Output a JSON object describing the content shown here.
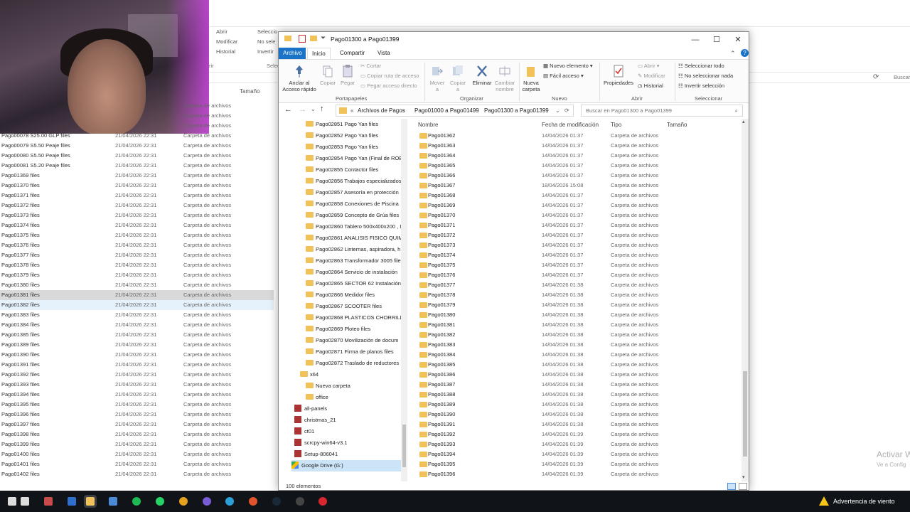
{
  "window": {
    "title": "Pago01300 a Pago01399",
    "tabs": [
      "Archivo",
      "Inicio",
      "Compartir",
      "Vista"
    ]
  },
  "ribbon": {
    "portapapeles": {
      "label": "Portapapeles",
      "anclar": "Anclar al\nAcceso rápido",
      "copiar": "Copiar",
      "pegar": "Pegar",
      "cortar": "Cortar",
      "copiar_ruta": "Copiar ruta de acceso",
      "pegar_acceso": "Pegar acceso directo"
    },
    "organizar": {
      "label": "Organizar",
      "mover": "Mover\na",
      "copiar": "Copiar\na",
      "eliminar": "Eliminar",
      "cambiar": "Cambiar\nnombre"
    },
    "nuevo": {
      "label": "Nuevo",
      "nueva_carpeta": "Nueva\ncarpeta",
      "nuevo_elemento": "Nuevo elemento",
      "facil_acceso": "Fácil acceso"
    },
    "abrir": {
      "label": "Abrir",
      "propiedades": "Propiedades",
      "abrir": "Abrir",
      "modificar": "Modificar",
      "historial": "Historial"
    },
    "seleccionar": {
      "label": "Seleccionar",
      "todo": "Seleccionar todo",
      "nada": "No seleccionar nada",
      "invertir": "Invertir selección"
    }
  },
  "address": {
    "crumbs": [
      "Archivos de Pagos",
      "Pago01000 a Pago01499",
      "Pago01300 a Pago01399"
    ],
    "search_placeholder": "Buscar en Pago01300 a Pago01399"
  },
  "nav": [
    {
      "label": "Pago02851 Pago Yan files",
      "indent": 1
    },
    {
      "label": "Pago02852 Pago Yan files",
      "indent": 1
    },
    {
      "label": "Pago02853 Pago Yan files",
      "indent": 1
    },
    {
      "label": "Pago02854 Pago Yan (Final de ROE",
      "indent": 1
    },
    {
      "label": "Pago02855 Contactor files",
      "indent": 1
    },
    {
      "label": "Pago02856 Trabajos especializados",
      "indent": 1
    },
    {
      "label": "Pago02857 Asesoría en protección",
      "indent": 1
    },
    {
      "label": "Pago02858 Conexiones de Piscina",
      "indent": 1
    },
    {
      "label": "Pago02859 Concepto de Grúa files",
      "indent": 1
    },
    {
      "label": "Pago02860 Tablero 500x400x200 , I",
      "indent": 1
    },
    {
      "label": "Pago02861 ANALISIS FISICO QUIM",
      "indent": 1
    },
    {
      "label": "Pago02862 Linternas, aspiradora, h",
      "indent": 1
    },
    {
      "label": "Pago02863 Transformador 3005 file",
      "indent": 1
    },
    {
      "label": "Pago02864 Servicio de instalación",
      "indent": 1
    },
    {
      "label": "Pago02865 SECTOR 62 Instalación",
      "indent": 1
    },
    {
      "label": "Pago02866 Medidor files",
      "indent": 1
    },
    {
      "label": "Pago02867 SCOOTER files",
      "indent": 1
    },
    {
      "label": "Pago02868 PLASTICOS CHORRILLC",
      "indent": 1
    },
    {
      "label": "Pago02869 Ploteo files",
      "indent": 1
    },
    {
      "label": "Pago02870 Movilización de docum",
      "indent": 1
    },
    {
      "label": "Pago02871 Firma de planos files",
      "indent": 1
    },
    {
      "label": "Pago02872 Traslado de reductores",
      "indent": 1
    },
    {
      "label": "x64",
      "indent": 0
    },
    {
      "label": "Nueva carpeta",
      "indent": 0
    },
    {
      "label": "office",
      "indent": 0
    },
    {
      "label": "all-panels",
      "indent": -1
    },
    {
      "label": "christmas_21",
      "indent": -1
    },
    {
      "label": "ct01",
      "indent": -1
    },
    {
      "label": "scrcpy-win64-v3.1",
      "indent": -1
    },
    {
      "label": "Setup-806041",
      "indent": -1
    },
    {
      "label": "Google Drive (G:)",
      "indent": -2
    }
  ],
  "columns": {
    "name": "Nombre",
    "date": "Fecha de modificación",
    "type": "Tipo",
    "size": "Tamaño"
  },
  "files": [
    {
      "name": "Pago01362",
      "date": "14/04/2026 01:37",
      "type": "Carpeta de archivos"
    },
    {
      "name": "Pago01363",
      "date": "14/04/2026 01:37",
      "type": "Carpeta de archivos"
    },
    {
      "name": "Pago01364",
      "date": "14/04/2026 01:37",
      "type": "Carpeta de archivos"
    },
    {
      "name": "Pago01365",
      "date": "14/04/2026 01:37",
      "type": "Carpeta de archivos"
    },
    {
      "name": "Pago01366",
      "date": "14/04/2026 01:37",
      "type": "Carpeta de archivos"
    },
    {
      "name": "Pago01367",
      "date": "18/04/2026 15:08",
      "type": "Carpeta de archivos"
    },
    {
      "name": "Pago01368",
      "date": "14/04/2026 01:37",
      "type": "Carpeta de archivos"
    },
    {
      "name": "Pago01369",
      "date": "14/04/2026 01:37",
      "type": "Carpeta de archivos"
    },
    {
      "name": "Pago01370",
      "date": "14/04/2026 01:37",
      "type": "Carpeta de archivos"
    },
    {
      "name": "Pago01371",
      "date": "14/04/2026 01:37",
      "type": "Carpeta de archivos"
    },
    {
      "name": "Pago01372",
      "date": "14/04/2026 01:37",
      "type": "Carpeta de archivos"
    },
    {
      "name": "Pago01373",
      "date": "14/04/2026 01:37",
      "type": "Carpeta de archivos"
    },
    {
      "name": "Pago01374",
      "date": "14/04/2026 01:37",
      "type": "Carpeta de archivos"
    },
    {
      "name": "Pago01375",
      "date": "14/04/2026 01:37",
      "type": "Carpeta de archivos"
    },
    {
      "name": "Pago01376",
      "date": "14/04/2026 01:37",
      "type": "Carpeta de archivos"
    },
    {
      "name": "Pago01377",
      "date": "14/04/2026 01:38",
      "type": "Carpeta de archivos"
    },
    {
      "name": "Pago01378",
      "date": "14/04/2026 01:38",
      "type": "Carpeta de archivos"
    },
    {
      "name": "Pago01379",
      "date": "14/04/2026 01:38",
      "type": "Carpeta de archivos"
    },
    {
      "name": "Pago01380",
      "date": "14/04/2026 01:38",
      "type": "Carpeta de archivos"
    },
    {
      "name": "Pago01381",
      "date": "14/04/2026 01:38",
      "type": "Carpeta de archivos"
    },
    {
      "name": "Pago01382",
      "date": "14/04/2026 01:38",
      "type": "Carpeta de archivos"
    },
    {
      "name": "Pago01383",
      "date": "14/04/2026 01:38",
      "type": "Carpeta de archivos"
    },
    {
      "name": "Pago01384",
      "date": "14/04/2026 01:38",
      "type": "Carpeta de archivos"
    },
    {
      "name": "Pago01385",
      "date": "14/04/2026 01:38",
      "type": "Carpeta de archivos"
    },
    {
      "name": "Pago01386",
      "date": "14/04/2026 01:38",
      "type": "Carpeta de archivos"
    },
    {
      "name": "Pago01387",
      "date": "14/04/2026 01:38",
      "type": "Carpeta de archivos"
    },
    {
      "name": "Pago01388",
      "date": "14/04/2026 01:38",
      "type": "Carpeta de archivos"
    },
    {
      "name": "Pago01389",
      "date": "14/04/2026 01:38",
      "type": "Carpeta de archivos"
    },
    {
      "name": "Pago01390",
      "date": "14/04/2026 01:38",
      "type": "Carpeta de archivos"
    },
    {
      "name": "Pago01391",
      "date": "14/04/2026 01:38",
      "type": "Carpeta de archivos"
    },
    {
      "name": "Pago01392",
      "date": "14/04/2026 01:39",
      "type": "Carpeta de archivos"
    },
    {
      "name": "Pago01393",
      "date": "14/04/2026 01:39",
      "type": "Carpeta de archivos"
    },
    {
      "name": "Pago01394",
      "date": "14/04/2026 01:39",
      "type": "Carpeta de archivos"
    },
    {
      "name": "Pago01395",
      "date": "14/04/2026 01:39",
      "type": "Carpeta de archivos"
    },
    {
      "name": "Pago01396",
      "date": "14/04/2026 01:39",
      "type": "Carpeta de archivos"
    }
  ],
  "status": "100 elementos",
  "bg_window": {
    "ribbon": [
      "Abrir",
      "Modificar",
      "Historial",
      "Seleccio",
      "No sele",
      "Invertir"
    ],
    "group_abrir": "rir",
    "group_sel": "Selec",
    "size_header": "Tamaño",
    "search": "Buscar",
    "rows": [
      {
        "name": "",
        "date": "",
        "type": "Carpeta de archivos"
      },
      {
        "name": "",
        "date": "",
        "type": "Carpeta de archivos"
      },
      {
        "name": "",
        "date": "",
        "type": "Carpeta de archivos"
      },
      {
        "name": "Pago00078 S25.00 GLP files",
        "date": "21/04/2026 22:31",
        "type": "Carpeta de archivos"
      },
      {
        "name": "Pago00079 S5.50 Peaje files",
        "date": "21/04/2026 22:31",
        "type": "Carpeta de archivos"
      },
      {
        "name": "Pago00080 S5.50 Peaje files",
        "date": "21/04/2026 22:31",
        "type": "Carpeta de archivos"
      },
      {
        "name": "Pago00081 S5.20 Peaje files",
        "date": "21/04/2026 22:31",
        "type": "Carpeta de archivos"
      },
      {
        "name": "Pago01369 files",
        "date": "21/04/2026 22:31",
        "type": "Carpeta de archivos"
      },
      {
        "name": "Pago01370 files",
        "date": "21/04/2026 22:31",
        "type": "Carpeta de archivos"
      },
      {
        "name": "Pago01371 files",
        "date": "21/04/2026 22:31",
        "type": "Carpeta de archivos"
      },
      {
        "name": "Pago01372 files",
        "date": "21/04/2026 22:31",
        "type": "Carpeta de archivos"
      },
      {
        "name": "Pago01373 files",
        "date": "21/04/2026 22:31",
        "type": "Carpeta de archivos"
      },
      {
        "name": "Pago01374 files",
        "date": "21/04/2026 22:31",
        "type": "Carpeta de archivos"
      },
      {
        "name": "Pago01375 files",
        "date": "21/04/2026 22:31",
        "type": "Carpeta de archivos"
      },
      {
        "name": "Pago01376 files",
        "date": "21/04/2026 22:31",
        "type": "Carpeta de archivos"
      },
      {
        "name": "Pago01377 files",
        "date": "21/04/2026 22:31",
        "type": "Carpeta de archivos"
      },
      {
        "name": "Pago01378 files",
        "date": "21/04/2026 22:31",
        "type": "Carpeta de archivos"
      },
      {
        "name": "Pago01379 files",
        "date": "21/04/2026 22:31",
        "type": "Carpeta de archivos"
      },
      {
        "name": "Pago01380 files",
        "date": "21/04/2026 22:31",
        "type": "Carpeta de archivos"
      },
      {
        "name": "Pago01381 files",
        "date": "21/04/2026 22:31",
        "type": "Carpeta de archivos"
      },
      {
        "name": "Pago01382 files",
        "date": "21/04/2026 22:31",
        "type": "Carpeta de archivos"
      },
      {
        "name": "Pago01383 files",
        "date": "21/04/2026 22:31",
        "type": "Carpeta de archivos"
      },
      {
        "name": "Pago01384 files",
        "date": "21/04/2026 22:31",
        "type": "Carpeta de archivos"
      },
      {
        "name": "Pago01385 files",
        "date": "21/04/2026 22:31",
        "type": "Carpeta de archivos"
      },
      {
        "name": "Pago01389 files",
        "date": "21/04/2026 22:31",
        "type": "Carpeta de archivos"
      },
      {
        "name": "Pago01390 files",
        "date": "21/04/2026 22:31",
        "type": "Carpeta de archivos"
      },
      {
        "name": "Pago01391 files",
        "date": "21/04/2026 22:31",
        "type": "Carpeta de archivos"
      },
      {
        "name": "Pago01392 files",
        "date": "21/04/2026 22:31",
        "type": "Carpeta de archivos"
      },
      {
        "name": "Pago01393 files",
        "date": "21/04/2026 22:31",
        "type": "Carpeta de archivos"
      },
      {
        "name": "Pago01394 files",
        "date": "21/04/2026 22:31",
        "type": "Carpeta de archivos"
      },
      {
        "name": "Pago01395 files",
        "date": "21/04/2026 22:31",
        "type": "Carpeta de archivos"
      },
      {
        "name": "Pago01396 files",
        "date": "21/04/2026 22:31",
        "type": "Carpeta de archivos"
      },
      {
        "name": "Pago01397 files",
        "date": "21/04/2026 22:31",
        "type": "Carpeta de archivos"
      },
      {
        "name": "Pago01398 files",
        "date": "21/04/2026 22:31",
        "type": "Carpeta de archivos"
      },
      {
        "name": "Pago01399 files",
        "date": "21/04/2026 22:31",
        "type": "Carpeta de archivos"
      },
      {
        "name": "Pago01400 files",
        "date": "21/04/2026 22:31",
        "type": "Carpeta de archivos"
      },
      {
        "name": "Pago01401 files",
        "date": "21/04/2026 22:31",
        "type": "Carpeta de archivos"
      },
      {
        "name": "Pago01402 files",
        "date": "21/04/2026 22:31",
        "type": "Carpeta de archivos"
      }
    ]
  },
  "activation": {
    "line1": "Activar W",
    "line2": "Ve a Config"
  },
  "taskbar": {
    "icons": [
      "search-icon",
      "task-view-icon",
      "calculator-icon",
      "outlook-icon",
      "explorer-icon",
      "mail-icon",
      "spotify-icon",
      "whatsapp-icon",
      "chrome-icon",
      "discord-icon",
      "edge-icon",
      "brave-icon",
      "steam-icon",
      "obs-icon",
      "opera-icon"
    ],
    "wind_warning": "Advertencia de viento"
  },
  "colors": {
    "accent": "#1a73c6",
    "folder": "#f1c15a",
    "taskbar": "#101418",
    "selection": "#cce4f7"
  }
}
